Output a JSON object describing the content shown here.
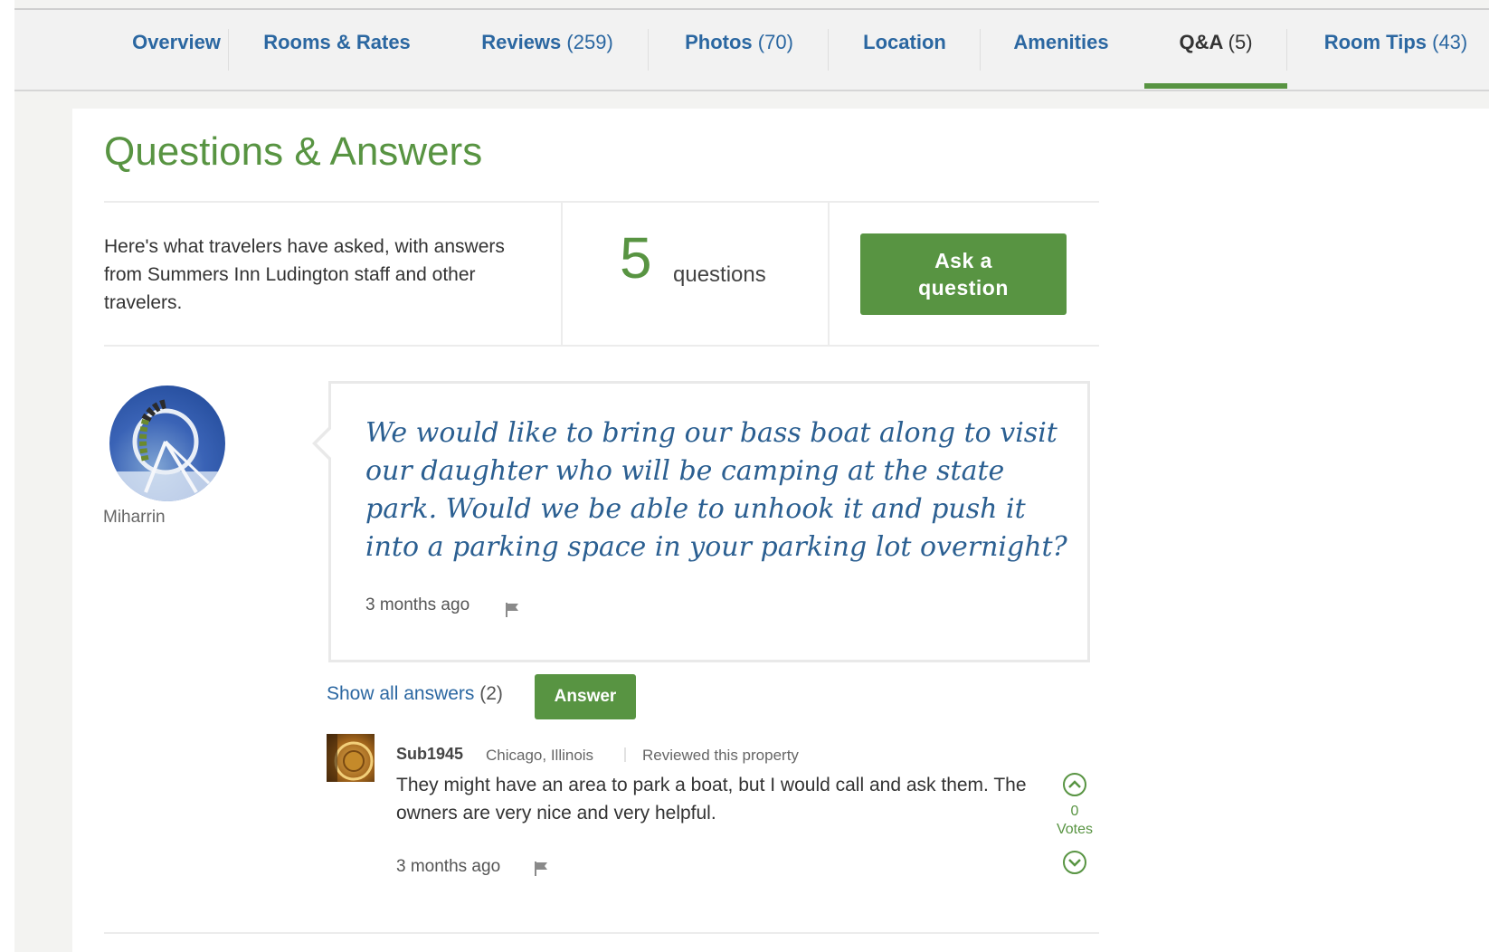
{
  "tabs": [
    {
      "label": "Overview",
      "count": ""
    },
    {
      "label": "Rooms & Rates",
      "count": ""
    },
    {
      "label": "Reviews",
      "count": "(259)"
    },
    {
      "label": "Photos",
      "count": "(70)"
    },
    {
      "label": "Location",
      "count": ""
    },
    {
      "label": "Amenities",
      "count": ""
    },
    {
      "label": "Q&A",
      "count": "(5)"
    },
    {
      "label": "Room Tips",
      "count": "(43)"
    }
  ],
  "active_tab": "Q&A",
  "section_title": "Questions & Answers",
  "summary": {
    "intro": "Here's what travelers have asked, with answers from Summers Inn Ludington staff and other travelers.",
    "question_count": "5",
    "question_label": "questions",
    "ask_button": "Ask a question"
  },
  "question": {
    "author": "Miharrin",
    "text": "We would like to bring our bass boat along to visit our daughter who will be camping at the state park. Would we be able to unhook it and push it into a parking space in your parking lot overnight?",
    "time": "3 months ago"
  },
  "answers_link": {
    "label": "Show all answers",
    "count": "(2)"
  },
  "answer_button": "Answer",
  "answer": {
    "user": "Sub1945",
    "location": "Chicago, Illinois",
    "badge": "Reviewed this property",
    "text": "They might have an area to park a boat, but I would call and ask them. The owners are very nice and very helpful.",
    "time": "3 months ago",
    "votes": "0",
    "votes_label": "Votes"
  },
  "colors": {
    "accent_green": "#589442",
    "link_blue": "#2b67a1",
    "question_blue": "#2b5f91"
  },
  "icons": [
    "flag-icon",
    "vote-up-icon",
    "vote-down-icon",
    "user-avatar",
    "answerer-avatar"
  ]
}
